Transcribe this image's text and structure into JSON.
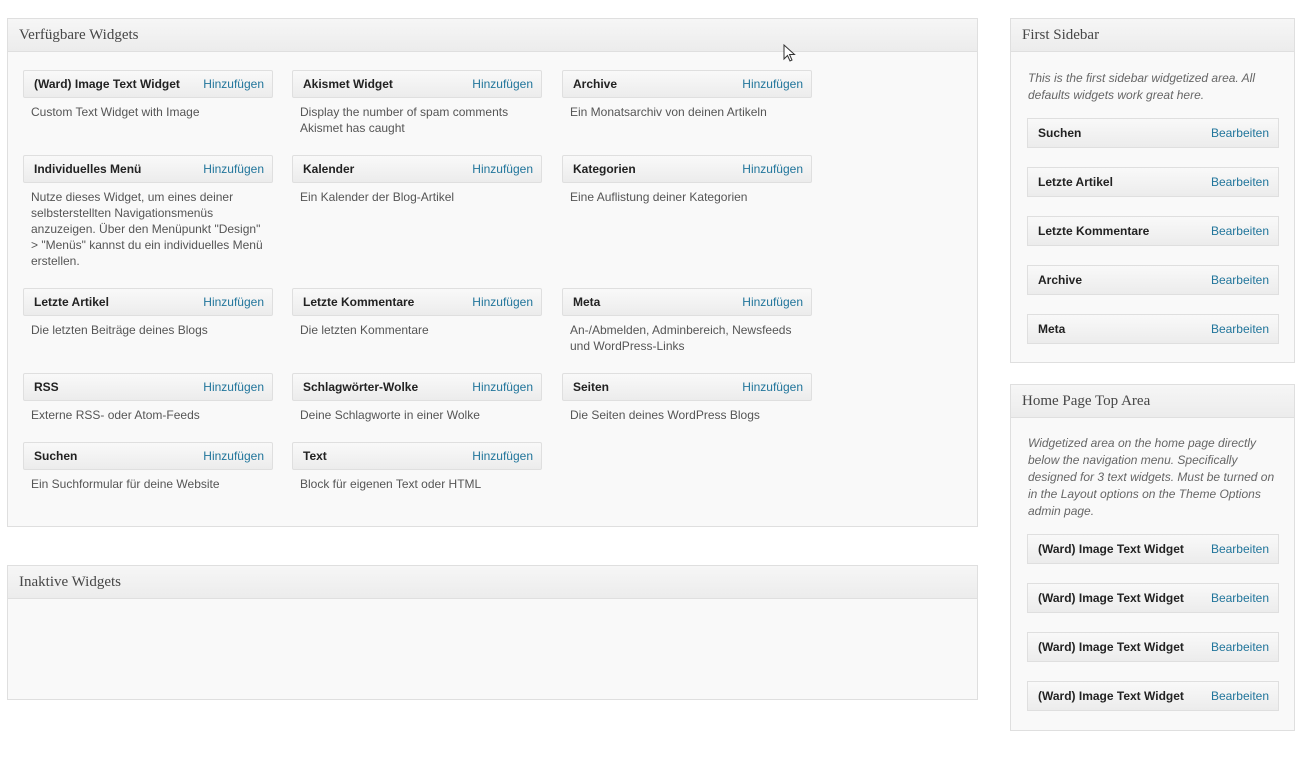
{
  "available": {
    "title": "Verfügbare Widgets",
    "widgets": [
      {
        "title": "(Ward) Image Text Widget",
        "action": "Hinzufügen",
        "desc": "Custom Text Widget with Image"
      },
      {
        "title": "Akismet Widget",
        "action": "Hinzufügen",
        "desc": "Display the number of spam comments Akismet has caught"
      },
      {
        "title": "Archive",
        "action": "Hinzufügen",
        "desc": "Ein Monatsarchiv von deinen Artikeln"
      },
      {
        "title": "Individuelles Menü",
        "action": "Hinzufügen",
        "desc": "Nutze dieses Widget, um eines deiner selbsterstellten Navigationsmenüs anzuzeigen. Über den Menüpunkt \"Design\" > \"Menüs\" kannst du ein individuelles Menü erstellen."
      },
      {
        "title": "Kalender",
        "action": "Hinzufügen",
        "desc": "Ein Kalender der Blog-Artikel"
      },
      {
        "title": "Kategorien",
        "action": "Hinzufügen",
        "desc": "Eine Auflistung deiner Kategorien"
      },
      {
        "title": "Letzte Artikel",
        "action": "Hinzufügen",
        "desc": "Die letzten Beiträge deines Blogs"
      },
      {
        "title": "Letzte Kommentare",
        "action": "Hinzufügen",
        "desc": "Die letzten Kommentare"
      },
      {
        "title": "Meta",
        "action": "Hinzufügen",
        "desc": "An-/Abmelden, Adminbereich, Newsfeeds und WordPress-Links"
      },
      {
        "title": "RSS",
        "action": "Hinzufügen",
        "desc": "Externe RSS- oder Atom-Feeds"
      },
      {
        "title": "Schlagwörter-Wolke",
        "action": "Hinzufügen",
        "desc": "Deine Schlagworte in einer Wolke"
      },
      {
        "title": "Seiten",
        "action": "Hinzufügen",
        "desc": "Die Seiten deines WordPress Blogs"
      },
      {
        "title": "Suchen",
        "action": "Hinzufügen",
        "desc": "Ein Suchformular für deine Website"
      },
      {
        "title": "Text",
        "action": "Hinzufügen",
        "desc": "Block für eigenen Text oder HTML"
      }
    ]
  },
  "inactive": {
    "title": "Inaktive Widgets"
  },
  "first_sidebar": {
    "title": "First Sidebar",
    "description": "This is the first sidebar widgetized area. All defaults widgets work great here.",
    "widgets": [
      {
        "title": "Suchen",
        "action": "Bearbeiten"
      },
      {
        "title": "Letzte Artikel",
        "action": "Bearbeiten"
      },
      {
        "title": "Letzte Kommentare",
        "action": "Bearbeiten"
      },
      {
        "title": "Archive",
        "action": "Bearbeiten"
      },
      {
        "title": "Meta",
        "action": "Bearbeiten"
      }
    ]
  },
  "home_top": {
    "title": "Home Page Top Area",
    "description": "Widgetized area on the home page directly below the navigation menu. Specifically designed for 3 text widgets. Must be turned on in the Layout options on the Theme Options admin page.",
    "widgets": [
      {
        "title": "(Ward) Image Text Widget",
        "action": "Bearbeiten"
      },
      {
        "title": "(Ward) Image Text Widget",
        "action": "Bearbeiten"
      },
      {
        "title": "(Ward) Image Text Widget",
        "action": "Bearbeiten"
      },
      {
        "title": "(Ward) Image Text Widget",
        "action": "Bearbeiten"
      }
    ]
  },
  "colors": {
    "link": "#21759b",
    "border": "#dfdfdf",
    "panel_bg": "#f9f9f9"
  },
  "icons": [
    "mouse-cursor-icon"
  ]
}
